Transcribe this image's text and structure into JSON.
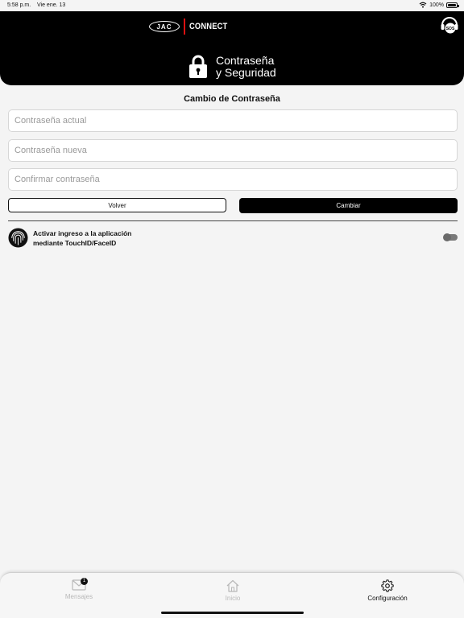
{
  "status_bar": {
    "time": "5:58 p.m.",
    "date": "Vie ene. 13",
    "battery": "100%"
  },
  "header": {
    "brand_logo": "JAC",
    "brand_name": "CONNECT",
    "title_line1": "Contraseña",
    "title_line2": "y Seguridad",
    "sos_label": "SOS"
  },
  "form": {
    "section_title": "Cambio de Contraseña",
    "current_password_placeholder": "Contraseña actual",
    "new_password_placeholder": "Contraseña nueva",
    "confirm_password_placeholder": "Confirmar contraseña",
    "back_label": "Volver",
    "change_label": "Cambiar"
  },
  "biometric": {
    "label_line1": "Activar ingreso a la aplicación",
    "label_line2": "mediante TouchID/FaceID",
    "enabled": false
  },
  "tabbar": {
    "messages_label": "Mensajes",
    "messages_badge": "1",
    "home_label": "Inicio",
    "config_label": "Configuración",
    "active_tab": "Configuración"
  },
  "colors": {
    "header_bg": "#000000",
    "page_bg": "#f4f4f4",
    "brand_accent": "#dd1111",
    "inactive_tab": "#b8b8b8"
  }
}
